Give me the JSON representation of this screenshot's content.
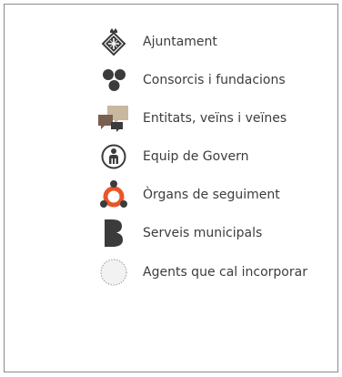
{
  "legend": {
    "items": [
      {
        "label": "Ajuntament",
        "icon": "city-hall-crest-icon"
      },
      {
        "label": "Consorcis i fundacions",
        "icon": "three-dots-cluster-icon"
      },
      {
        "label": "Entitats, veïns i veïnes",
        "icon": "speech-bubbles-icon"
      },
      {
        "label": "Equip de Govern",
        "icon": "person-in-circle-icon"
      },
      {
        "label": "Òrgans de seguiment",
        "icon": "connected-nodes-icon"
      },
      {
        "label": "Serveis municipals",
        "icon": "letter-b-icon"
      },
      {
        "label": "Agents que cal incorporar",
        "icon": "dashed-circle-icon"
      }
    ],
    "colors": {
      "dark": "#3b3b3b",
      "bubble_tan": "#c8b8a0",
      "bubble_brown": "#7a6050",
      "organs_orange": "#e8552a"
    }
  }
}
